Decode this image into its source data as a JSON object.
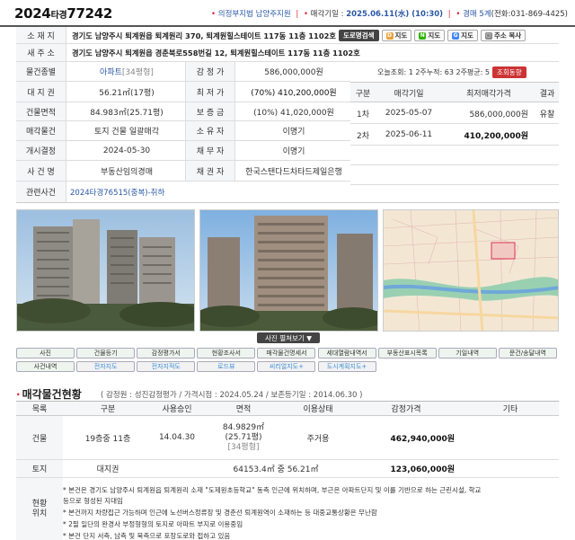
{
  "header": {
    "case_year": "2024",
    "case_type": "타경",
    "case_num": "77242",
    "court": "의정부지법 남양주지원",
    "sale_date_label": "매각기일 :",
    "sale_date": "2025.06.11(水) (10:30)",
    "dept": "경매 5계",
    "phone": "(전화:031-869-4425)"
  },
  "address": {
    "label": "소 재 지",
    "value": "경기도 남양주시 퇴계원읍 퇴계원리 370, 퇴계원힐스테이트 117동 11층 1102호",
    "btn_road": "도로명검색",
    "btn_daum": "지도",
    "btn_naver": "지도",
    "btn_google": "지도",
    "btn_copy": "주소 복사"
  },
  "new_address": {
    "label": "새 주 소",
    "value": "경기도 남양주시 퇴계원읍 경춘북로558번길 12, 퇴계원힐스테이트 117동 11층 1102호"
  },
  "details": [
    {
      "label": "물건종별",
      "value": "아파트",
      "extra": "[34평형]",
      "label2": "감 정 가",
      "value2": "586,000,000원"
    },
    {
      "label": "대 지 권",
      "value": "56.21㎡(17평)",
      "label2": "최 저 가",
      "value2": "(70%) 410,200,000원"
    },
    {
      "label": "건물면적",
      "value": "84.983㎡(25.71평)",
      "label2": "보 증 금",
      "value2": "(10%) 41,020,000원"
    },
    {
      "label": "매각물건",
      "value": "토지 건물 일괄매각",
      "label2": "소 유 자",
      "value2": "이명기"
    },
    {
      "label": "개시결정",
      "value": "2024-05-30",
      "label2": "채 무 자",
      "value2": "이명기"
    },
    {
      "label": "사 건 명",
      "value": "부동산임의경매",
      "label2": "채 권 자",
      "value2": "한국스탠다드차타드제일은행"
    }
  ],
  "related": {
    "label": "관련사건",
    "value": "2024타경76515(중복)-취하"
  },
  "views": {
    "today_label": "오늘조회:",
    "today": "1",
    "two_weeks_label": "2주누적:",
    "two_weeks": "63",
    "avg_label": "2주평균:",
    "avg": "5",
    "btn": "조회동향"
  },
  "history": {
    "headers": [
      "구분",
      "매각기일",
      "최저매각가격",
      "결과"
    ],
    "rows": [
      {
        "round": "1차",
        "date": "2025-05-07",
        "price": "586,000,000원",
        "result": "유찰"
      },
      {
        "round": "2차",
        "date": "2025-06-11",
        "price": "410,200,000원",
        "result": ""
      }
    ]
  },
  "photo_toggle": "사진 펼쳐보기",
  "nav_row1": [
    "사진",
    "건물등기",
    "감정평가서",
    "현황조사서",
    "매각물건명세서",
    "세대열람내역서",
    "부동산표시목록",
    "기일내역",
    "문건/송달내역"
  ],
  "nav_row2": [
    "사건내역",
    "전자지도",
    "전자지적도",
    "로드뷰",
    "씨리얼지도+",
    "도시계획지도+"
  ],
  "section": {
    "title": "매각물건현황",
    "sub": "( 감정원 : 성진감정평가 / 가격시점 : 2024.05.24 / 보존등기일 : 2014.06.30 )",
    "headers": [
      "목록",
      "구분",
      "사용승인",
      "면적",
      "이용상태",
      "감정가격",
      "기타"
    ],
    "building": {
      "label": "건물",
      "kind": "19층중 11층",
      "approved": "14.04.30",
      "area1": "84.9829㎡",
      "area2": "(25.71평)",
      "area3": "[34평형]",
      "use": "주거용",
      "price": "462,940,000원"
    },
    "land": {
      "label": "토지",
      "kind": "대지권",
      "area": "64153.4㎡ 중 56.21㎡",
      "price": "123,060,000원"
    },
    "status_label": "현황 위치",
    "notes": [
      "* 본건은 경기도 남양주시 퇴계원읍 퇴계원리 소재 \"도제원초등학교\" 동측 인근에 위치하며, 부근은 아파트단지 및 이를 기반으로 하는 근린시설, 학교",
      "  등으로 형성된 지대임",
      "* 본건까지 차량접근 가능하며 인근에 노선버스정류장 및 경춘선 퇴계원역이 소재하는 등 대중교통상황은 무난함",
      "* 2필 일단의 완경사 부정형형의 토지로 아파트 부지로 이용중임",
      "* 본건 단지 서측, 남측 및 북측으로 포장도로와 접하고 있음"
    ]
  }
}
